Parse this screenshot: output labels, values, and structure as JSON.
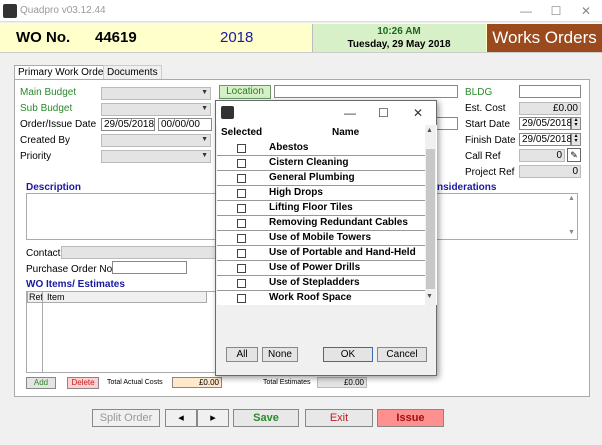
{
  "window": {
    "title": "Quadpro v03.12.44",
    "minimize": "—",
    "maximize": "☐",
    "close": "✕"
  },
  "header": {
    "wo_label": "WO No.",
    "wo_number": "44619",
    "year": "2018",
    "time": "10:26 AM",
    "date": "Tuesday, 29 May 2018",
    "brand": "Works Orders"
  },
  "tabs": [
    {
      "label": "Primary Work Order"
    },
    {
      "label": "Documents"
    }
  ],
  "form": {
    "main_budget": "Main Budget",
    "sub_budget": "Sub Budget",
    "order_issue_date": "Order/Issue Date",
    "order_date_value": "29/05/2018",
    "order_time_value": "00/00/00",
    "created_by": "Created By",
    "priority": "Priority",
    "location_button": "Location",
    "bldg": "BLDG",
    "est_cost": "Est. Cost",
    "est_cost_value": "£0.00",
    "start_date": "Start Date",
    "start_date_value": "29/05/2018",
    "finish_date": "Finish Date",
    "finish_date_value": "29/05/2018",
    "call_ref": "Call Ref",
    "call_ref_value": "0",
    "project_ref": "Project Ref",
    "project_ref_value": "0",
    "description": "Description",
    "considerations": "nsiderations",
    "contact": "Contact",
    "purchase_order_no": "Purchase Order No.",
    "wo_items_estimates": "WO Items/ Estimates",
    "grid_ref": "Ref",
    "grid_item": "Item",
    "add": "Add",
    "delete": "Delete",
    "total_actual_costs": "Total Actual Costs",
    "total_actual_costs_value": "£0.00",
    "total_estimates": "Total Estimates",
    "total_estimates_value": "£0.00"
  },
  "bottom_buttons": {
    "split_order": "Split Order",
    "prev": "◂",
    "next": "▸",
    "save": "Save",
    "exit": "Exit",
    "issue": "Issue"
  },
  "dialog": {
    "min": "—",
    "max": "☐",
    "close": "✕",
    "col_selected": "Selected",
    "col_name": "Name",
    "items": [
      "Abestos",
      "Cistern Cleaning",
      "General Plumbing",
      "High Drops",
      "Lifting Floor Tiles",
      "Removing Redundant Cables",
      "Use of Mobile Towers",
      "Use of Portable and Hand-Held",
      "Use of Power Drills",
      "Use of Stepladders",
      "Work Roof Space"
    ],
    "btn_all": "All",
    "btn_none": "None",
    "btn_ok": "OK",
    "btn_cancel": "Cancel"
  },
  "colors": {
    "brand_bg": "#9a4a1c",
    "header_bg": "#ffffcc",
    "clock_bg": "#d8f0c8",
    "save_green": "#2a8a2a",
    "exit_red": "#c02020",
    "issue_bg": "#ff9090"
  }
}
